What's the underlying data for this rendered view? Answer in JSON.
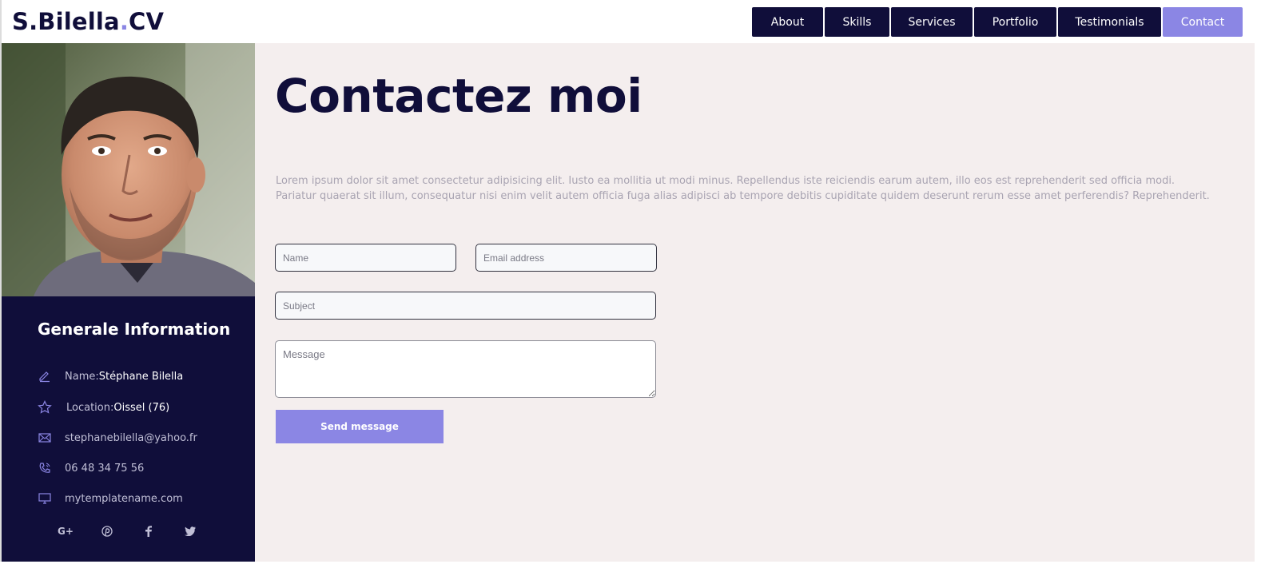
{
  "logo": {
    "text_main": "S.Bilella",
    "text_dot": ".",
    "text_end": "CV"
  },
  "nav": {
    "items": [
      {
        "label": "About"
      },
      {
        "label": "Skills"
      },
      {
        "label": "Services"
      },
      {
        "label": "Portfolio"
      },
      {
        "label": "Testimonials"
      },
      {
        "label": "Contact",
        "active": true
      }
    ]
  },
  "sidebar": {
    "title": "Generale Information",
    "name_label": "Name: ",
    "name_value": "Stéphane Bilella",
    "location_label": "Location: ",
    "location_value": "Oissel (76)",
    "email": "stephanebilella@yahoo.fr",
    "phone": "06 48 34 75 56",
    "website": "mytemplatename.com",
    "socials": [
      "google-plus-icon",
      "pinterest-icon",
      "facebook-icon",
      "twitter-icon"
    ]
  },
  "main": {
    "heading": "Contactez moi",
    "lorem": "Lorem ipsum dolor sit amet consectetur adipisicing elit. Iusto ea mollitia ut modi minus. Repellendus iste reiciendis earum autem, illo eos est reprehenderit sed officia modi. Pariatur quaerat sit illum, consequatur nisi enim velit autem officia fuga alias adipisci ab tempore debitis cupiditate quidem deserunt rerum esse amet perferendis? Reprehenderit.",
    "form": {
      "name_placeholder": "Name",
      "email_placeholder": "Email address",
      "subject_placeholder": "Subject",
      "message_placeholder": "Message",
      "send_label": "Send message"
    }
  },
  "colors": {
    "navy": "#100e3a",
    "accent": "#8b86e4",
    "main_bg": "#f4eeee",
    "muted_text": "#a9a4b2"
  }
}
